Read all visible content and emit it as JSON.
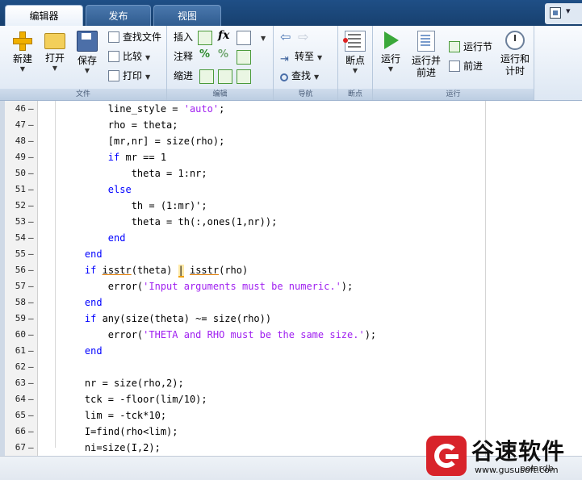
{
  "tabs": [
    {
      "label": "编辑器",
      "active": true
    },
    {
      "label": "发布",
      "active": false
    },
    {
      "label": "视图",
      "active": false
    }
  ],
  "ribbon": {
    "file": {
      "title": "文件",
      "new": "新建",
      "open": "打开",
      "save": "保存",
      "find_files": "查找文件",
      "compare": "比较",
      "print": "打印"
    },
    "edit": {
      "title": "编辑",
      "insert": "插入",
      "comment": "注释",
      "indent": "缩进",
      "fx": "fx"
    },
    "navigate": {
      "title": "导航",
      "goto": "转至",
      "find": "查找"
    },
    "breakpoints": {
      "title": "断点",
      "breakpoints": "断点"
    },
    "run": {
      "title": "运行",
      "run": "运行",
      "run_advance_1": "运行并",
      "run_advance_2": "前进",
      "run_section": "运行节",
      "advance": "前进",
      "run_time_1": "运行和",
      "run_time_2": "计时"
    }
  },
  "code_lines": [
    {
      "n": "46",
      "tokens": [
        {
          "t": "        line_style = "
        },
        {
          "t": "'auto'",
          "c": "str"
        },
        {
          "t": ";"
        }
      ]
    },
    {
      "n": "47",
      "tokens": [
        {
          "t": "        rho = theta;"
        }
      ]
    },
    {
      "n": "48",
      "tokens": [
        {
          "t": "        [mr,nr] = size(rho);"
        }
      ]
    },
    {
      "n": "49",
      "tokens": [
        {
          "t": "        "
        },
        {
          "t": "if",
          "c": "kw"
        },
        {
          "t": " mr == 1"
        }
      ]
    },
    {
      "n": "50",
      "tokens": [
        {
          "t": "            theta = 1:nr;"
        }
      ]
    },
    {
      "n": "51",
      "tokens": [
        {
          "t": "        "
        },
        {
          "t": "else",
          "c": "kw"
        }
      ]
    },
    {
      "n": "52",
      "tokens": [
        {
          "t": "            th = (1:mr)';"
        }
      ]
    },
    {
      "n": "53",
      "tokens": [
        {
          "t": "            theta = th(:,ones(1,nr));"
        }
      ]
    },
    {
      "n": "54",
      "tokens": [
        {
          "t": "        "
        },
        {
          "t": "end",
          "c": "kw"
        }
      ]
    },
    {
      "n": "55",
      "tokens": [
        {
          "t": "    "
        },
        {
          "t": "end",
          "c": "kw"
        }
      ]
    },
    {
      "n": "56",
      "tokens": [
        {
          "t": "    "
        },
        {
          "t": "if",
          "c": "kw"
        },
        {
          "t": " "
        },
        {
          "t": "isstr",
          "c": "ul"
        },
        {
          "t": "(theta) "
        },
        {
          "t": "|",
          "c": "hl"
        },
        {
          "t": " "
        },
        {
          "t": "isstr",
          "c": "ul"
        },
        {
          "t": "(rho)"
        }
      ]
    },
    {
      "n": "57",
      "tokens": [
        {
          "t": "        error("
        },
        {
          "t": "'Input arguments must be numeric.'",
          "c": "str"
        },
        {
          "t": ");"
        }
      ]
    },
    {
      "n": "58",
      "tokens": [
        {
          "t": "    "
        },
        {
          "t": "end",
          "c": "kw"
        }
      ]
    },
    {
      "n": "59",
      "tokens": [
        {
          "t": "    "
        },
        {
          "t": "if",
          "c": "kw"
        },
        {
          "t": " any(size(theta) ~= size(rho))"
        }
      ]
    },
    {
      "n": "60",
      "tokens": [
        {
          "t": "        error("
        },
        {
          "t": "'THETA and RHO must be the same size.'",
          "c": "str"
        },
        {
          "t": ");"
        }
      ]
    },
    {
      "n": "61",
      "tokens": [
        {
          "t": "    "
        },
        {
          "t": "end",
          "c": "kw"
        }
      ]
    },
    {
      "n": "62",
      "tokens": []
    },
    {
      "n": "63",
      "tokens": [
        {
          "t": "    nr = size(rho,2);"
        }
      ]
    },
    {
      "n": "64",
      "tokens": [
        {
          "t": "    tck = -floor(lim/10);"
        }
      ]
    },
    {
      "n": "65",
      "tokens": [
        {
          "t": "    lim = -tck*10;"
        }
      ]
    },
    {
      "n": "66",
      "tokens": [
        {
          "t": "    I=find(rho<lim);"
        }
      ]
    },
    {
      "n": "67",
      "tokens": [
        {
          "t": "    ni=size(I,2);"
        }
      ]
    }
  ],
  "status": {
    "file_name": "polardb"
  },
  "watermark": {
    "name": "谷速软件",
    "url": "www.gususoft.com"
  },
  "colors": {
    "keyword": "#0000ff",
    "string": "#a020f0",
    "tabbar": "#1f4f86",
    "accent": "#d8232a"
  }
}
